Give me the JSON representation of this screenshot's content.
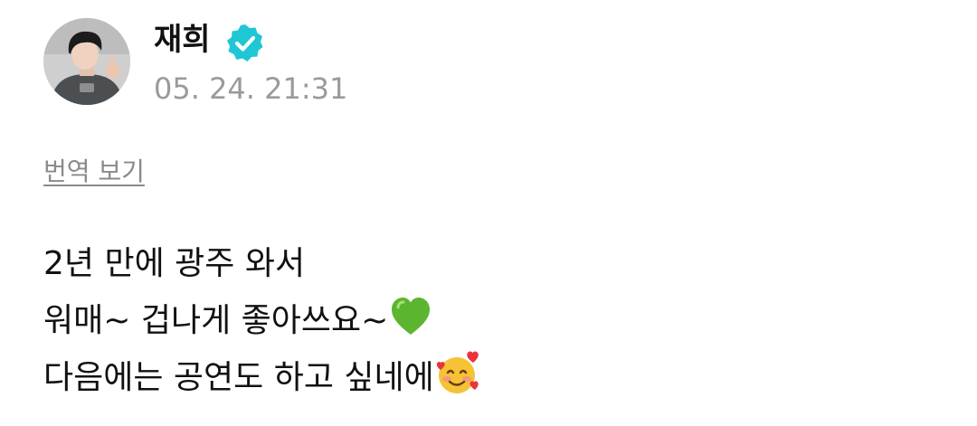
{
  "post": {
    "author": {
      "name": "재희",
      "verified": true,
      "avatar_icon": "profile-photo",
      "verified_icon": "verified-badge-icon"
    },
    "timestamp": "05. 24. 21:31",
    "translate_label": "번역 보기",
    "lines": [
      {
        "text": "2년 만에 광주 와서",
        "emoji": null
      },
      {
        "text": "워매~ 겁나게 좋아쓰요~",
        "emoji": "green-heart-emoji"
      },
      {
        "text": "다음에는 공연도 하고 싶네에",
        "emoji": "smiling-face-with-hearts-emoji"
      }
    ]
  },
  "colors": {
    "verified_badge": "#1fc7d4",
    "timestamp": "#9a9a9a",
    "translate_link": "#8a8a8a",
    "text": "#111111"
  }
}
